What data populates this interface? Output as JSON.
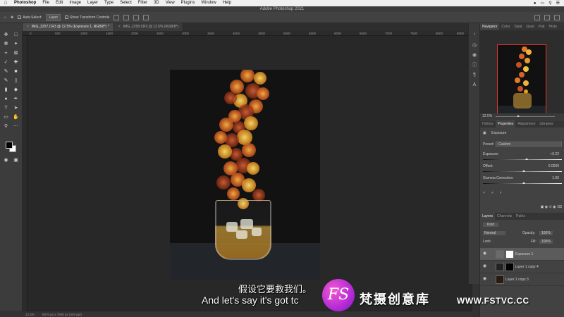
{
  "menubar": {
    "app": "Photoshop",
    "items": [
      "File",
      "Edit",
      "Image",
      "Layer",
      "Type",
      "Select",
      "Filter",
      "3D",
      "View",
      "Plugins",
      "Window",
      "Help"
    ]
  },
  "window": {
    "title": "Adobe Photoshop 2021"
  },
  "options": {
    "auto_select": "Auto-Select:",
    "layer_select": "Layer",
    "show_transform": "Show Transform Controls"
  },
  "tabs": [
    {
      "label": "IMG_2257.CR3 @ 12.5% (Exposure 1, RGB/8*) *",
      "active": true
    },
    {
      "label": "IMG_2258.CR3 @ 12.5% (RGB/8*)",
      "active": false
    }
  ],
  "ruler": [
    "0",
    "500",
    "1000",
    "1500",
    "2000",
    "2500",
    "3000",
    "3500",
    "4000",
    "4500",
    "5000",
    "5500",
    "6000",
    "6500",
    "7000",
    "7500",
    "8000",
    "8500"
  ],
  "status": {
    "zoom": "12.5%",
    "size": "6070 px x 7808 px (300 ppi)"
  },
  "navigator": {
    "tabs": [
      "Navigator",
      "Color",
      "Swat",
      "Grad",
      "Patt",
      "Histo"
    ],
    "zoom": "12.5%"
  },
  "properties": {
    "tabs": [
      "History",
      "Properties",
      "Adjustment",
      "Libraries"
    ],
    "title": "Exposure",
    "preset_label": "Preset:",
    "preset_value": "Custom",
    "exposure_label": "Exposure:",
    "exposure_value": "+0.22",
    "offset_label": "Offset:",
    "offset_value": "0.0000",
    "gamma_label": "Gamma Correction:",
    "gamma_value": "1.00"
  },
  "layers": {
    "tabs": [
      "Layers",
      "Channels",
      "Paths"
    ],
    "kind": "Kind",
    "blend": "Normal",
    "opacity_label": "Opacity:",
    "opacity_value": "100%",
    "lock_label": "Lock:",
    "fill_label": "Fill:",
    "fill_value": "100%",
    "rows": [
      "Exposure 1",
      "Layer 1 copy 4",
      "Layer 1 copy 3"
    ]
  },
  "subtitles": {
    "cn": "假设它要救我们。",
    "en": "And let's say it's got tc"
  },
  "watermark": {
    "logo": "FS",
    "cn": "梵摄创意库",
    "url": "WWW.FSTVC.CC"
  },
  "colors": {
    "accent_red": "#e0342d",
    "logo_pink": "#d03ad8"
  }
}
